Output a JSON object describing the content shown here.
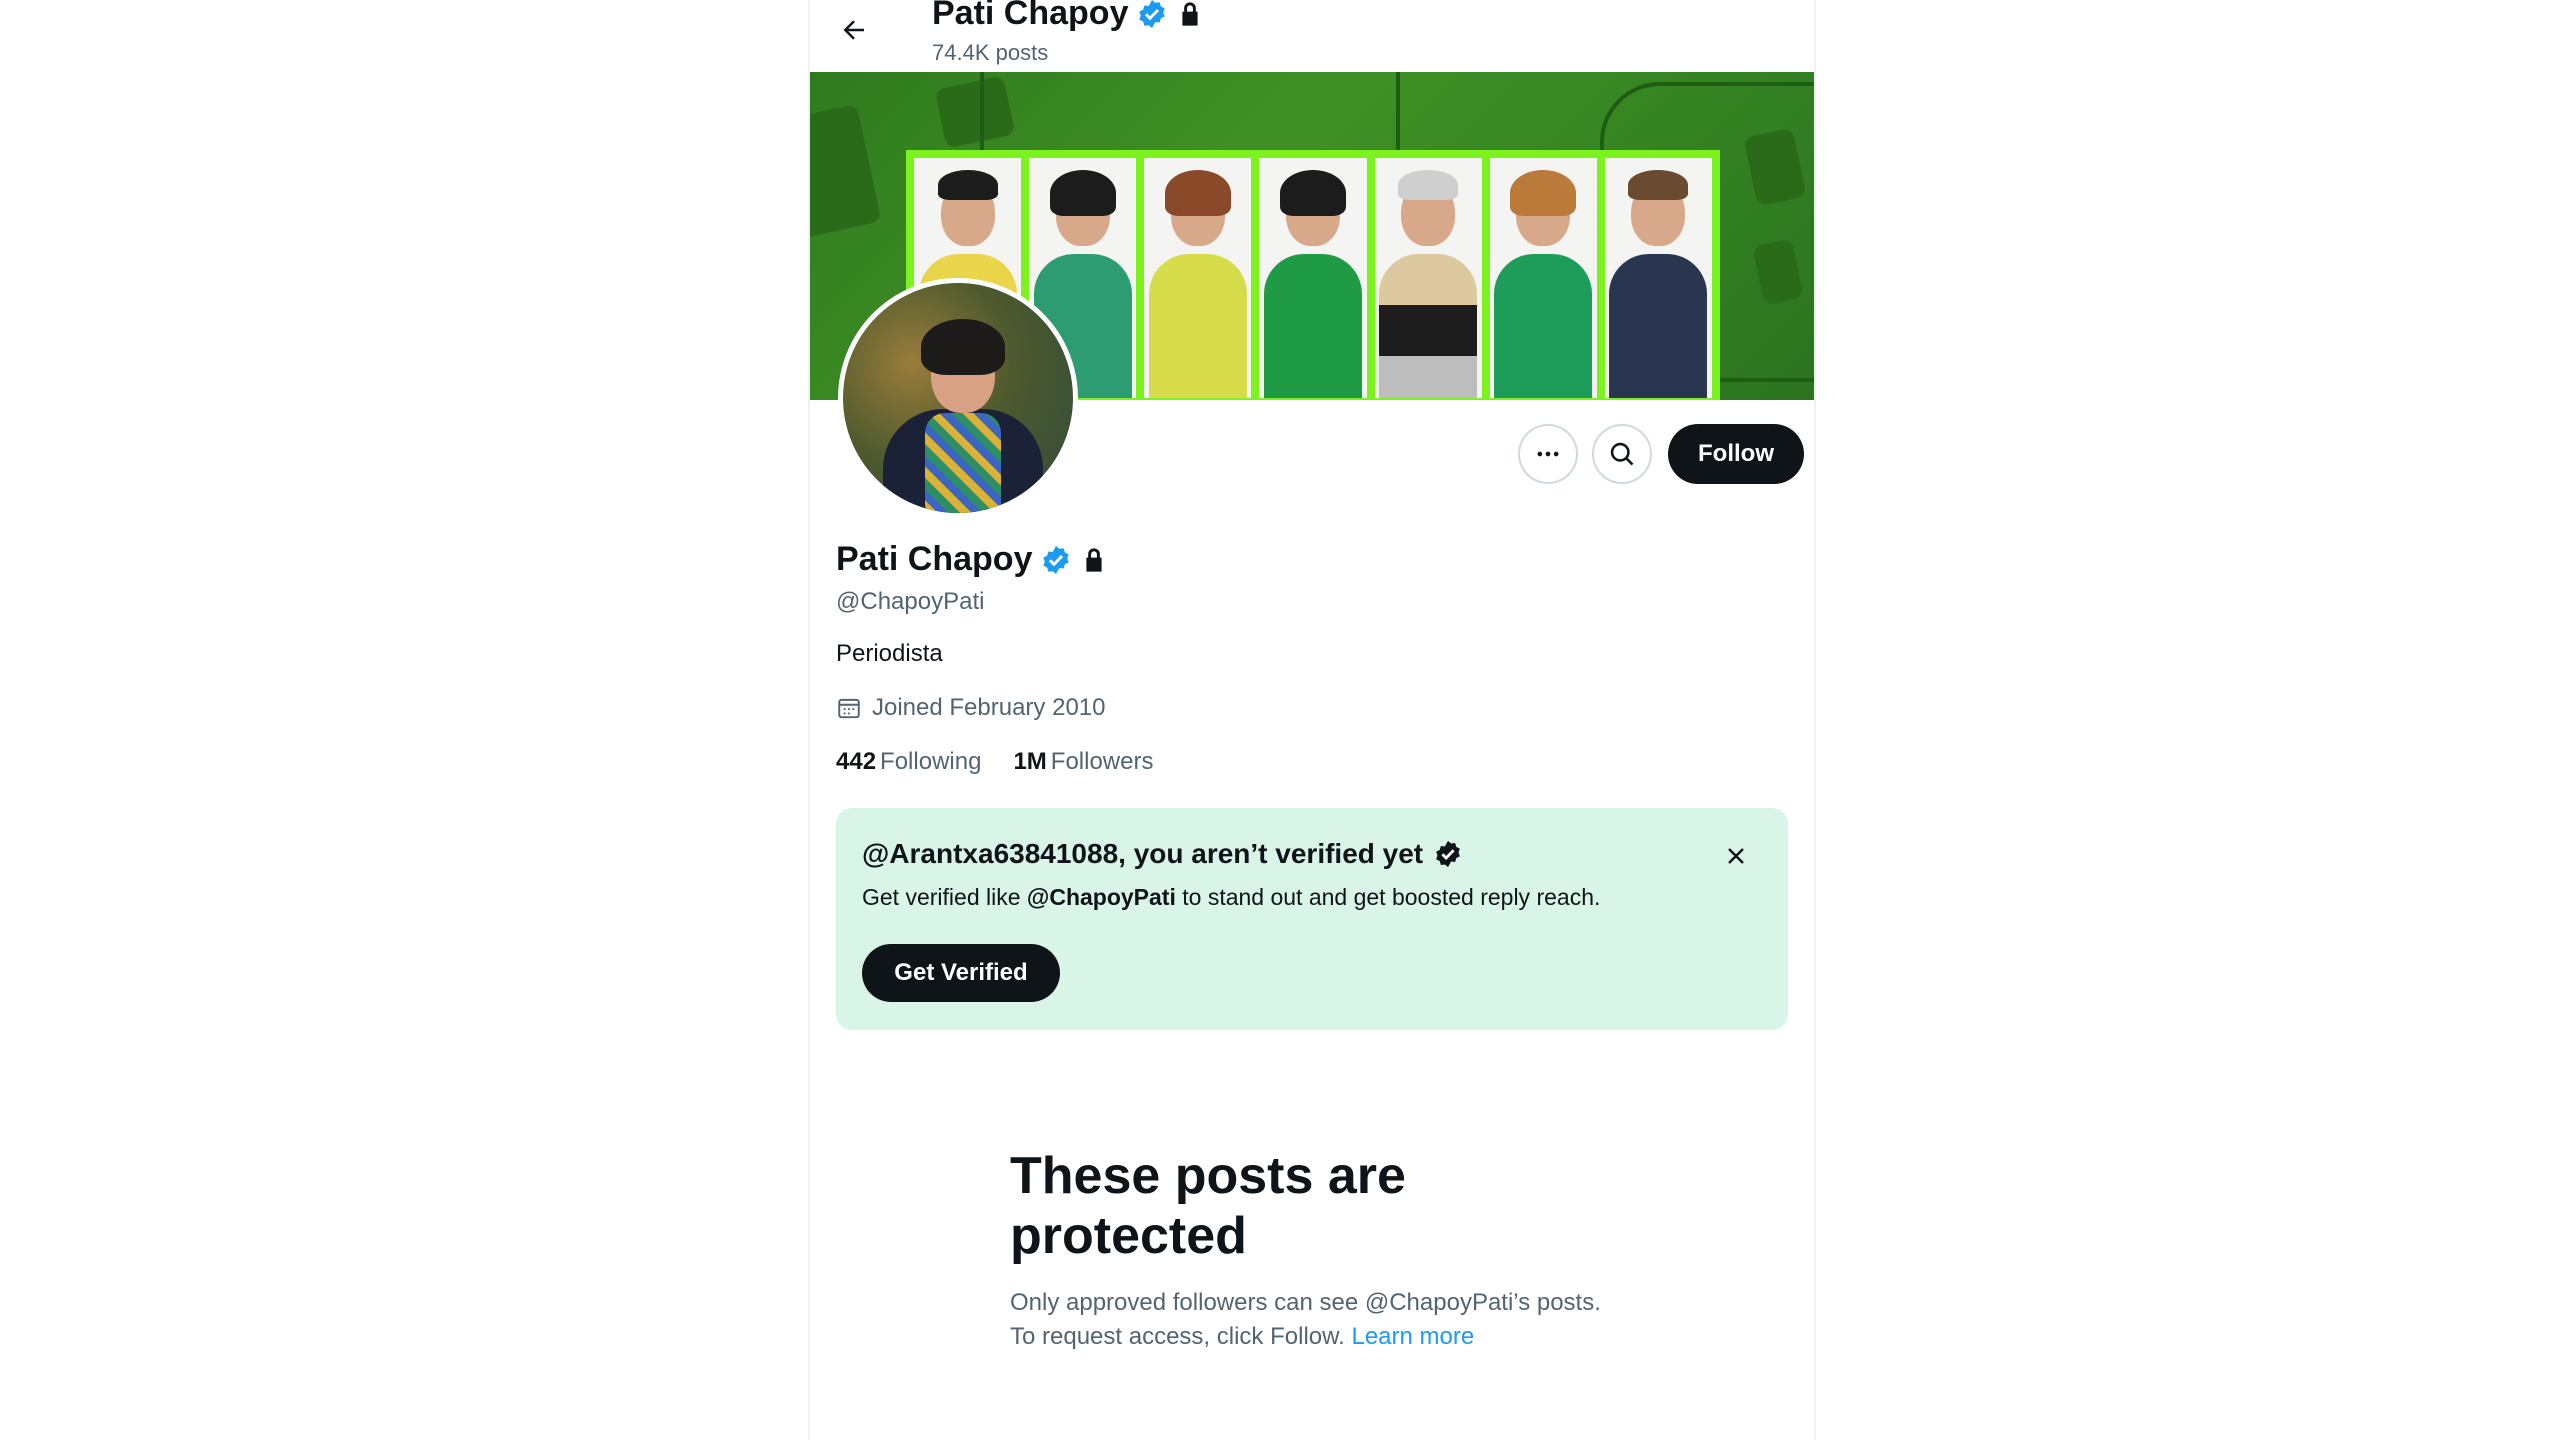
{
  "header": {
    "name": "Pati Chapoy",
    "posts_count": "74.4K posts"
  },
  "profile": {
    "name": "Pati Chapoy",
    "handle": "@ChapoyPati",
    "bio": "Periodista",
    "joined": "Joined February 2010",
    "following_count": "442",
    "following_label": "Following",
    "followers_count": "1M",
    "followers_label": "Followers",
    "follow_label": "Follow"
  },
  "verify_card": {
    "title": "@Arantxa63841088, you aren’t verified yet",
    "desc_prefix": "Get verified like ",
    "desc_handle": "@ChapoyPati",
    "desc_suffix": " to stand out and get boosted reply reach.",
    "button_label": "Get Verified"
  },
  "protected": {
    "title": "These posts are protected",
    "text": "Only approved followers can see @ChapoyPati’s posts. To request access, click Follow. ",
    "link": "Learn more"
  },
  "colors": {
    "accent": "#1d9bf0",
    "verify_bg": "#d9f5e8",
    "banner_green": "#3f9125",
    "panel_lime": "#7cf21e"
  },
  "icons": [
    "back-arrow-icon",
    "verified-badge-icon",
    "lock-icon",
    "more-icon",
    "search-icon",
    "calendar-icon",
    "close-icon"
  ]
}
